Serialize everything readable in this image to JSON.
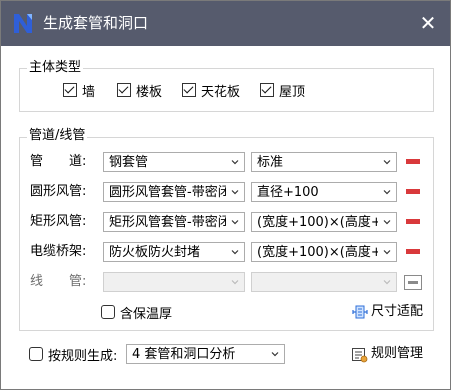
{
  "window": {
    "title": "生成套管和洞口",
    "close_glyph": "✕"
  },
  "body_type": {
    "label": "主体类型",
    "options": [
      {
        "label": "墙",
        "checked": true
      },
      {
        "label": "楼板",
        "checked": true
      },
      {
        "label": "天花板",
        "checked": true
      },
      {
        "label": "屋顶",
        "checked": true
      }
    ]
  },
  "pipes": {
    "label": "管道/线管",
    "rows": [
      {
        "label": "管　　道:",
        "type": "钢套管",
        "size": "标准",
        "enabled": true
      },
      {
        "label": "圆形风管:",
        "type": "圆形风管套管-带密闭",
        "size": "直径+100",
        "enabled": true
      },
      {
        "label": "矩形风管:",
        "type": "矩形风管套管-带密闭",
        "size": "(宽度+100)×(高度+",
        "enabled": true
      },
      {
        "label": "电缆桥架:",
        "type": "防火板防火封堵",
        "size": "(宽度+100)×(高度+",
        "enabled": true
      },
      {
        "label": "线　　管:",
        "type": "",
        "size": "",
        "enabled": false
      }
    ],
    "insulation": {
      "label": "含保温厚",
      "checked": false
    },
    "size_fit": {
      "label": "尺寸适配",
      "icon": "size-fit-icon"
    }
  },
  "footer": {
    "rule_generate": {
      "label": "按规则生成:",
      "checked": false
    },
    "rule_select": "4 套管和洞口分析",
    "rule_manage": {
      "label": "规则管理",
      "icon": "rule-manage-icon"
    }
  },
  "colors": {
    "titlebar": "#565b6d",
    "remove": "#d9393b",
    "logo": "#2f5fd8"
  }
}
